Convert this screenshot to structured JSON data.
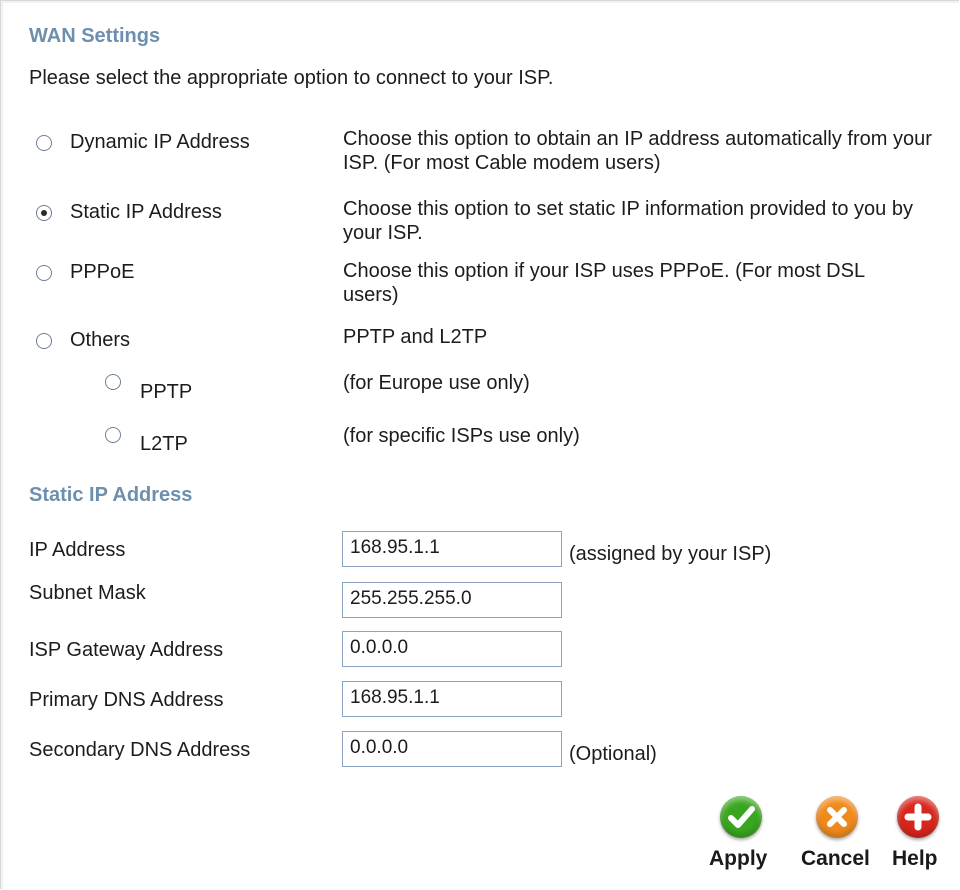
{
  "wan": {
    "title": "WAN Settings",
    "intro": "Please select the appropriate option to connect to your ISP."
  },
  "options": [
    {
      "label": "Dynamic IP Address",
      "desc": "Choose this option to obtain an IP address automatically from your ISP. (For most Cable modem users)",
      "checked": false
    },
    {
      "label": "Static IP Address",
      "desc": "Choose this option to set static IP information provided to you by your ISP.",
      "checked": true
    },
    {
      "label": "PPPoE",
      "desc": "Choose this option if your ISP uses PPPoE. (For most DSL users)",
      "checked": false
    },
    {
      "label": "Others",
      "desc": "PPTP and L2TP",
      "checked": false
    },
    {
      "label": "PPTP",
      "desc": "(for Europe use only)",
      "checked": false
    },
    {
      "label": "L2TP",
      "desc": "(for specific ISPs use only)",
      "checked": false
    }
  ],
  "static": {
    "title": "Static IP Address",
    "fields": [
      {
        "label": "IP Address",
        "value": "168.95.1.1",
        "note": "(assigned by your ISP)"
      },
      {
        "label": "Subnet Mask",
        "value": "255.255.255.0",
        "note": ""
      },
      {
        "label": "ISP Gateway Address",
        "value": "0.0.0.0",
        "note": ""
      },
      {
        "label": "Primary DNS Address",
        "value": "168.95.1.1",
        "note": ""
      },
      {
        "label": "Secondary DNS Address",
        "value": "0.0.0.0",
        "note": "(Optional)"
      }
    ]
  },
  "actions": {
    "apply": "Apply",
    "cancel": "Cancel",
    "help": "Help",
    "apply_icon": "check-icon",
    "cancel_icon": "x-icon",
    "help_icon": "plus-icon",
    "apply_color": "#3aa61f",
    "cancel_color": "#f08a1c",
    "help_color": "#d8261c"
  },
  "colors": {
    "section_title": "#6d8fae",
    "input_border": "#8aa4c4"
  }
}
